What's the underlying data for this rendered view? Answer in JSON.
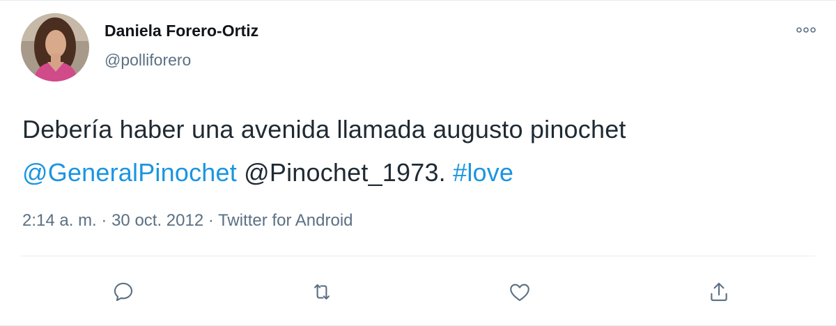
{
  "author": {
    "display_name": "Daniela Forero-Ortiz",
    "handle": "@polliforero",
    "avatar_icon": "profile-photo"
  },
  "tweet": {
    "text_plain": "Debería haber una avenida llamada augusto pinochet",
    "mention_1": "@GeneralPinochet",
    "mention_2": "@Pinochet_1973.",
    "hashtag": "#love"
  },
  "meta": {
    "time": "2:14 a. m.",
    "separator": "·",
    "date": "30 oct. 2012",
    "source": "Twitter for Android"
  },
  "actions": {
    "reply_icon": "reply-icon",
    "retweet_icon": "retweet-icon",
    "like_icon": "heart-icon",
    "share_icon": "share-icon"
  },
  "colors": {
    "link": "#1b95e0",
    "secondary_text": "#5b7083",
    "primary_text": "#0f1419",
    "divider": "#e6ecf0"
  }
}
